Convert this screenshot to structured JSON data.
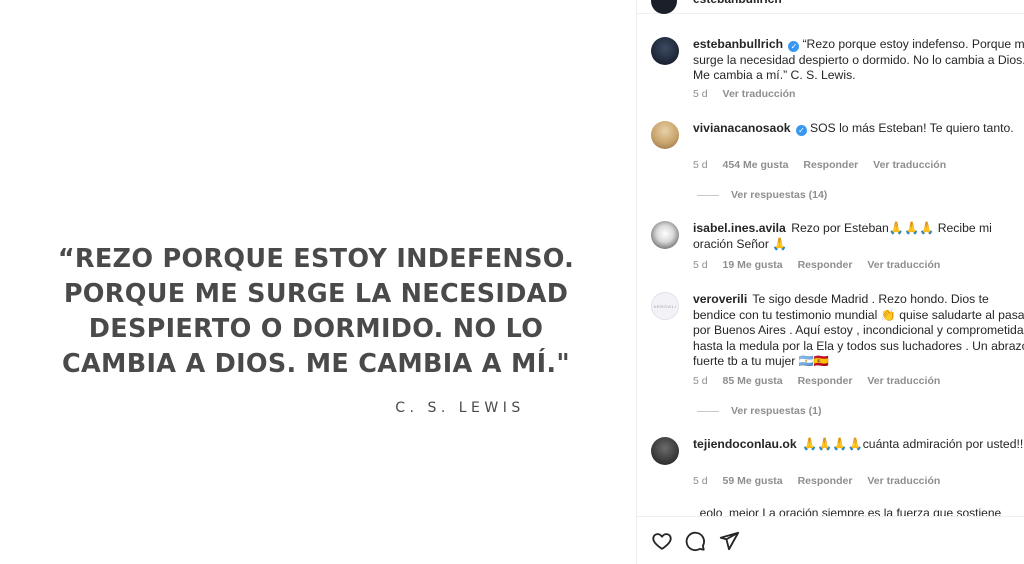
{
  "post": {
    "quote": "“REZO PORQUE ESTOY INDEFENSO. PORQUE ME SURGE LA NECESIDAD DESPIERTO O DORMIDO. NO LO CAMBIA A DIOS. ME CAMBIA A MÍ.\"",
    "author": "C. S. LEWIS"
  },
  "header": {
    "username": "estebanbullrich"
  },
  "comments": [
    {
      "username": "estebanbullrich",
      "verified": true,
      "text": "“Rezo porque estoy indefenso. Porque me surge la necesidad despierto o dormido. No lo cambia a Dios. Me cambia a mí.” C. S. Lewis.",
      "time": "5 d",
      "likes": "",
      "reply": "",
      "translate": "Ver traducción"
    },
    {
      "username": "vivianacanosaok",
      "verified": true,
      "text": "SOS lo más Esteban! Te quiero tanto.",
      "time": "5 d",
      "likes": "454 Me gusta",
      "reply": "Responder",
      "translate": "Ver traducción",
      "view_replies": "Ver respuestas (14)"
    },
    {
      "username": "isabel.ines.avila",
      "verified": false,
      "text": "Rezo por Esteban🙏🙏🙏 Recibe mi oración Señor 🙏",
      "time": "5 d",
      "likes": "19 Me gusta",
      "reply": "Responder",
      "translate": "Ver traducción"
    },
    {
      "username": "veroverili",
      "verified": false,
      "avatar_text": "VEROVILI",
      "text": "Te sigo desde Madrid . Rezo hondo. Dios te bendice con tu testimonio mundial 👏 quise saludarte al pasar por Buenos Aires . Aquí estoy , incondicional y comprometida hasta la medula por la Ela y todos sus luchadores . Un abrazo fuerte tb a tu mujer 🇦🇷🇪🇸",
      "time": "5 d",
      "likes": "85 Me gusta",
      "reply": "Responder",
      "translate": "Ver traducción",
      "view_replies": "Ver respuestas (1)"
    },
    {
      "username": "tejiendoconlau.ok",
      "verified": false,
      "text": "🙏🙏🙏🙏cuánta admiración por usted!!!",
      "time": "5 d",
      "likes": "59 Me gusta",
      "reply": "Responder",
      "translate": "Ver traducción"
    }
  ],
  "cut_comment": "_eolo_mejor  La oración siempre es la fuerza que sostiene",
  "actions": {
    "like": "heart-icon",
    "comment": "comment-icon",
    "share": "share-icon"
  }
}
